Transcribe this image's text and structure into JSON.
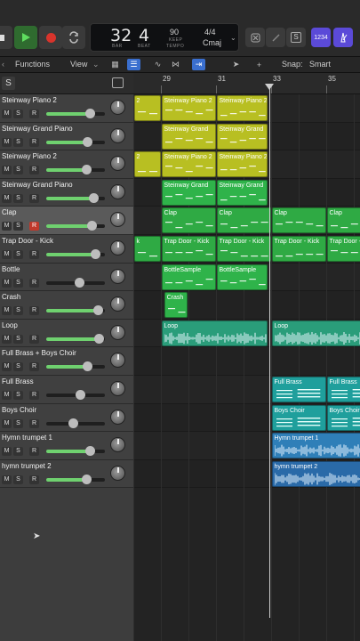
{
  "colors": {
    "yellow": "#b8bf22",
    "green": "#2fb34a",
    "green_clap": "#2faa44",
    "teal_loop": "#2a9d7a",
    "teal": "#1f9f9c",
    "blue": "#2f7fb8",
    "blue_dark": "#2a6aa8",
    "record": "#c0392b",
    "volume_fill": "#6fd16f"
  },
  "transport": {
    "bar": "32",
    "beat": "4",
    "bar_caption": "BAR",
    "beat_caption": "BEAT",
    "tempo": "90",
    "tempo_mode": "KEEP",
    "tempo_caption": "TEMPO",
    "time_signature": "4/4",
    "key": "Cmaj",
    "count_in_label": "1234",
    "play_icon": "play-icon",
    "record_icon": "record-icon",
    "cycle_icon": "cycle-icon"
  },
  "toolbar": {
    "functions": "Functions",
    "view": "View",
    "snap_label": "Snap:",
    "snap_value": "Smart"
  },
  "header": {
    "solo_label": "S"
  },
  "ruler": {
    "bars": [
      "29",
      "31",
      "33",
      "35"
    ]
  },
  "tracks": [
    {
      "name": "Steinway Piano 2",
      "mute": "M",
      "solo": "S",
      "rec": "R",
      "rec_armed": false,
      "volume": 0.74,
      "selected": false
    },
    {
      "name": "Steinway Grand Piano",
      "mute": "M",
      "solo": "S",
      "rec": "R",
      "rec_armed": false,
      "volume": 0.7,
      "selected": false
    },
    {
      "name": "Steinway Piano 2",
      "mute": "M",
      "solo": "S",
      "rec": "R",
      "rec_armed": false,
      "volume": 0.68,
      "selected": false
    },
    {
      "name": "Steinway Grand Piano",
      "mute": "M",
      "solo": "S",
      "rec": "R",
      "rec_armed": false,
      "volume": 0.8,
      "selected": false
    },
    {
      "name": "Clap",
      "mute": "M",
      "solo": "S",
      "rec": "R",
      "rec_armed": true,
      "volume": 0.78,
      "selected": true
    },
    {
      "name": "Trap Door - Kick",
      "mute": "M",
      "solo": "S",
      "rec": "R",
      "rec_armed": false,
      "volume": 0.84,
      "selected": false
    },
    {
      "name": "Bottle",
      "mute": "M",
      "solo": "S",
      "rec": "R",
      "rec_armed": false,
      "volume": 0.56,
      "selected": false
    },
    {
      "name": "Crash",
      "mute": "M",
      "solo": "S",
      "rec": "R",
      "rec_armed": false,
      "volume": 0.88,
      "selected": false
    },
    {
      "name": "Loop",
      "mute": "M",
      "solo": "S",
      "rec": "R",
      "rec_armed": false,
      "volume": 0.9,
      "selected": false
    },
    {
      "name": "Full Brass + Boys Choir",
      "mute": "M",
      "solo": "S",
      "rec": "R",
      "rec_armed": false,
      "volume": 0.7,
      "selected": false
    },
    {
      "name": "Full Brass",
      "mute": "M",
      "solo": "S",
      "rec": "R",
      "rec_armed": false,
      "volume": 0.58,
      "selected": false
    },
    {
      "name": "Boys Choir",
      "mute": "M",
      "solo": "S",
      "rec": "R",
      "rec_armed": false,
      "volume": 0.46,
      "selected": false
    },
    {
      "name": "Hymn trumpet 1",
      "mute": "M",
      "solo": "S",
      "rec": "R",
      "rec_armed": false,
      "volume": 0.74,
      "selected": false
    },
    {
      "name": "hymn trumpet 2",
      "mute": "M",
      "solo": "S",
      "rec": "R",
      "rec_armed": false,
      "volume": 0.68,
      "selected": false
    }
  ],
  "regions": [
    {
      "lane": 0,
      "start_bar": 28.0,
      "end_bar": 29.0,
      "label": "2",
      "color": "yellow",
      "kind": "midi"
    },
    {
      "lane": 0,
      "start_bar": 29.0,
      "end_bar": 31.0,
      "label": "Steinway Piano 2",
      "color": "yellow",
      "kind": "midi"
    },
    {
      "lane": 0,
      "start_bar": 31.0,
      "end_bar": 32.9,
      "label": "Steinway Piano 2",
      "color": "yellow",
      "kind": "midi"
    },
    {
      "lane": 1,
      "start_bar": 29.0,
      "end_bar": 31.0,
      "label": "Steinway Grand",
      "color": "yellow",
      "kind": "midi"
    },
    {
      "lane": 1,
      "start_bar": 31.0,
      "end_bar": 32.9,
      "label": "Steinway Grand",
      "color": "yellow",
      "kind": "midi"
    },
    {
      "lane": 2,
      "start_bar": 28.0,
      "end_bar": 29.0,
      "label": "2",
      "color": "yellow",
      "kind": "midi"
    },
    {
      "lane": 2,
      "start_bar": 29.0,
      "end_bar": 31.0,
      "label": "Steinway Piano 2",
      "color": "yellow",
      "kind": "midi"
    },
    {
      "lane": 2,
      "start_bar": 31.0,
      "end_bar": 32.9,
      "label": "Steinway Piano 2",
      "color": "yellow",
      "kind": "midi"
    },
    {
      "lane": 3,
      "start_bar": 29.0,
      "end_bar": 31.0,
      "label": "Steinway Grand",
      "color": "green",
      "kind": "midi"
    },
    {
      "lane": 3,
      "start_bar": 31.0,
      "end_bar": 32.9,
      "label": "Steinway Grand",
      "color": "green",
      "kind": "midi"
    },
    {
      "lane": 4,
      "start_bar": 29.0,
      "end_bar": 31.0,
      "label": "Clap",
      "color": "green_clap",
      "kind": "midi"
    },
    {
      "lane": 4,
      "start_bar": 31.0,
      "end_bar": 33.0,
      "label": "Clap",
      "color": "green_clap",
      "kind": "midi"
    },
    {
      "lane": 4,
      "start_bar": 33.0,
      "end_bar": 35.0,
      "label": "Clap",
      "color": "green_clap",
      "kind": "midi"
    },
    {
      "lane": 4,
      "start_bar": 35.0,
      "end_bar": 37.0,
      "label": "Clap",
      "color": "green_clap",
      "kind": "midi"
    },
    {
      "lane": 5,
      "start_bar": 28.0,
      "end_bar": 29.0,
      "label": "k",
      "color": "green_clap",
      "kind": "midi"
    },
    {
      "lane": 5,
      "start_bar": 29.0,
      "end_bar": 31.0,
      "label": "Trap Door - Kick",
      "color": "green_clap",
      "kind": "midi"
    },
    {
      "lane": 5,
      "start_bar": 31.0,
      "end_bar": 33.0,
      "label": "Trap Door - Kick",
      "color": "green_clap",
      "kind": "midi"
    },
    {
      "lane": 5,
      "start_bar": 33.0,
      "end_bar": 35.0,
      "label": "Trap Door - Kick",
      "color": "green_clap",
      "kind": "midi"
    },
    {
      "lane": 5,
      "start_bar": 35.0,
      "end_bar": 37.0,
      "label": "Trap Door - Kick",
      "color": "green_clap",
      "kind": "midi"
    },
    {
      "lane": 6,
      "start_bar": 29.0,
      "end_bar": 31.0,
      "label": "BottleSample",
      "color": "green",
      "kind": "midi"
    },
    {
      "lane": 6,
      "start_bar": 31.0,
      "end_bar": 32.9,
      "label": "BottleSample",
      "color": "green",
      "kind": "midi"
    },
    {
      "lane": 7,
      "start_bar": 29.1,
      "end_bar": 30.0,
      "label": "Crash",
      "color": "green",
      "kind": "midi"
    },
    {
      "lane": 8,
      "start_bar": 29.0,
      "end_bar": 32.9,
      "label": "Loop",
      "color": "teal_loop",
      "kind": "audio"
    },
    {
      "lane": 8,
      "start_bar": 33.0,
      "end_bar": 37.0,
      "label": "Loop",
      "color": "teal_loop",
      "kind": "audio"
    },
    {
      "lane": 10,
      "start_bar": 33.0,
      "end_bar": 35.0,
      "label": "Full Brass",
      "color": "teal",
      "kind": "score"
    },
    {
      "lane": 10,
      "start_bar": 35.0,
      "end_bar": 37.0,
      "label": "Full Brass",
      "color": "teal",
      "kind": "score"
    },
    {
      "lane": 11,
      "start_bar": 33.0,
      "end_bar": 35.0,
      "label": "Boys Choir",
      "color": "teal",
      "kind": "score"
    },
    {
      "lane": 11,
      "start_bar": 35.0,
      "end_bar": 37.0,
      "label": "Boys Choir",
      "color": "teal",
      "kind": "score"
    },
    {
      "lane": 12,
      "start_bar": 33.0,
      "end_bar": 37.0,
      "label": "Hymn trumpet 1",
      "color": "blue",
      "kind": "audio"
    },
    {
      "lane": 13,
      "start_bar": 33.0,
      "end_bar": 37.0,
      "label": "hymn trumpet 2",
      "color": "blue_dark",
      "kind": "audio"
    }
  ],
  "playhead_bar": 32.95
}
